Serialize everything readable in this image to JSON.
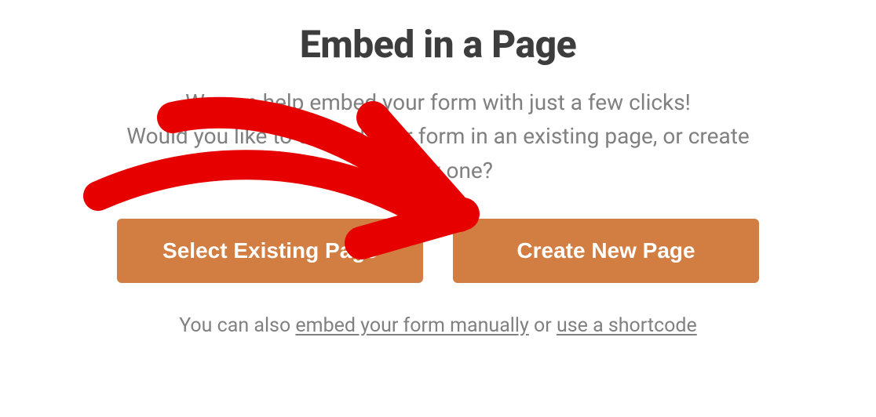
{
  "title": "Embed in a Page",
  "description_line1": "We can help embed your form with just a few clicks!",
  "description_line2": "Would you like to embed your form in an existing page, or create",
  "description_line3": "a new one?",
  "buttons": {
    "select_existing": "Select Existing Page",
    "create_new": "Create New Page"
  },
  "footer": {
    "prefix": "You can also ",
    "link_manual": "embed your form manually",
    "middle": " or ",
    "link_shortcode": "use a shortcode"
  }
}
